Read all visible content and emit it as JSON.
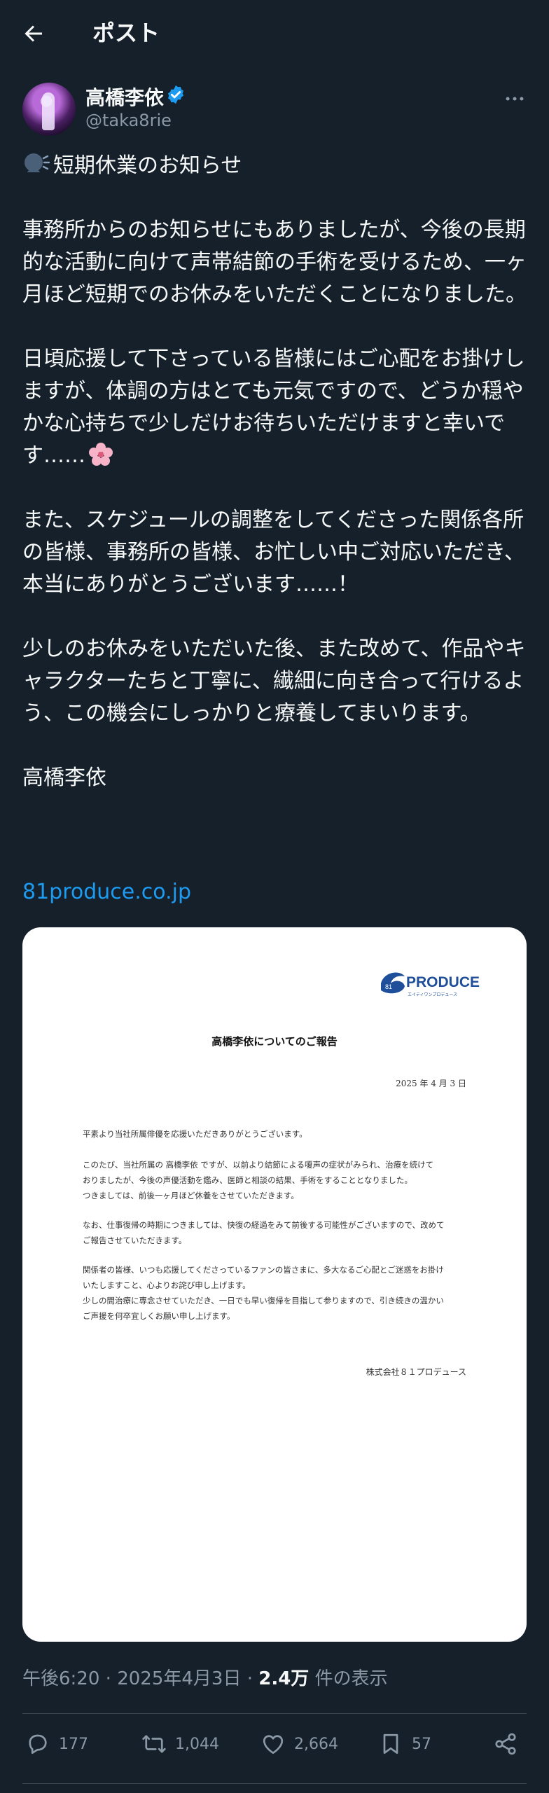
{
  "header": {
    "title": "ポスト"
  },
  "author": {
    "display_name": "高橋李依",
    "handle": "@taka8rie"
  },
  "post": {
    "first_line": "短期休業のお知らせ",
    "paragraph_1": "事務所からのお知らせにもありましたが、今後の長期的な活動に向けて声帯結節の手術を受けるため、一ヶ月ほど短期でのお休みをいただくことになりました。",
    "paragraph_2": "日頃応援して下さっている皆様にはご心配をお掛けしますが、体調の方はとても元気ですので、どうか穏やかな心持ちで少しだけお待ちいただけますと幸いです……",
    "paragraph_3": "また、スケジュールの調整をしてくださった関係各所の皆様、事務所の皆様、お忙しい中ご対応いただき、本当にありがとうございます……！",
    "paragraph_4": "少しのお休みをいただいた後、また改めて、作品やキャラクターたちと丁寧に、繊細に向き合って行けるよう、この機会にしっかりと療養してまいります。",
    "signature": "高橋李依",
    "link_text": "81produce.co.jp",
    "icons": {
      "lead": "speaking-head-icon",
      "end": "cherry-blossom-icon"
    }
  },
  "document": {
    "logo_text": "PRODUCE",
    "logo_subtext": "エイティワンプロデュース",
    "title": "高橋李依についてのご報告",
    "date": "2025 年 4 月 3 日",
    "para_1": "平素より当社所属俳優を応援いただきありがとうございます。",
    "para_2": "このたび、当社所属の 高橋李依 ですが、以前より結節による嗄声の症状がみられ、治療を続けて\nおりましたが、今後の声優活動を鑑み、医師と相談の結果、手術をすることとなりました。\nつきましては、前後一ヶ月ほど休養をさせていただきます。",
    "para_3": "なお、仕事復帰の時期につきましては、快復の経過をみて前後する可能性がございますので、改めて\nご報告させていただきます。",
    "para_4": "関係者の皆様、いつも応援してくださっているファンの皆さまに、多大なるご心配とご迷惑をお掛け\nいたしますこと、心よりお詫び申し上げます。\n少しの間治療に専念させていただき、一日でも早い復帰を目指して参りますので、引き続きの温かい\nご声援を何卒宜しくお願い申し上げます。",
    "company": "株式会社８１プロデュース"
  },
  "meta": {
    "time": "午後6:20",
    "date": "2025年4月3日",
    "separator": "·",
    "views_count": "2.4万",
    "views_label": "件の表示"
  },
  "actions": {
    "replies": "177",
    "reposts": "1,044",
    "likes": "2,664",
    "bookmarks": "57"
  },
  "colors": {
    "background": "#15202b",
    "text": "#f7f9f9",
    "secondary": "#8b98a5",
    "accent": "#1d9bf0",
    "divider": "#38444d"
  }
}
